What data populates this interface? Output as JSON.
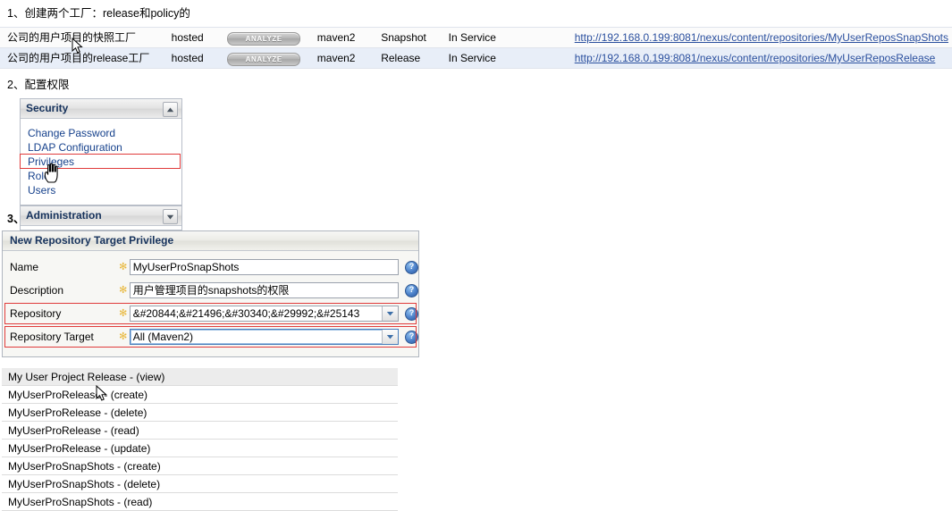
{
  "steps": {
    "step1": "1、创建两个工厂：release和policy的",
    "step2": "2、配置权限",
    "step3": "3、"
  },
  "repo_table": {
    "rows": [
      {
        "name": "公司的用户项目的快照工厂",
        "type": "hosted",
        "action_label": "ANALYZE",
        "format": "maven2",
        "policy": "Snapshot",
        "status": "In Service",
        "url": "http://192.168.0.199:8081/nexus/content/repositories/MyUserReposSnapShots"
      },
      {
        "name": "公司的用户项目的release工厂",
        "type": "hosted",
        "action_label": "ANALYZE",
        "format": "maven2",
        "policy": "Release",
        "status": "In Service",
        "url": "http://192.168.0.199:8081/nexus/content/repositories/MyUserReposRelease"
      }
    ]
  },
  "security_panel": {
    "title": "Security",
    "toggle_icon": "collapse-up-icon",
    "items": [
      {
        "label": "Change Password"
      },
      {
        "label": "LDAP Configuration"
      },
      {
        "label": "Privileges"
      },
      {
        "label": "Roles"
      },
      {
        "label": "Users"
      }
    ]
  },
  "admin_panel": {
    "title": "Administration",
    "toggle_icon": "expand-down-icon"
  },
  "privilege_form": {
    "title": "New Repository Target Privilege",
    "required_marker": "✻",
    "help_glyph": "?",
    "fields": [
      {
        "label": "Name",
        "value": "MyUserProSnapShots",
        "kind": "text",
        "highlighted": false,
        "focused": false
      },
      {
        "label": "Description",
        "value": "用户管理项目的snapshots的权限",
        "kind": "text",
        "highlighted": false,
        "focused": false
      },
      {
        "label": "Repository",
        "value": "&#20844;&#21496;&#30340;&#29992;&#25143",
        "kind": "select",
        "highlighted": true,
        "focused": false
      },
      {
        "label": "Repository Target",
        "value": "All (Maven2)",
        "kind": "select",
        "highlighted": true,
        "focused": true
      }
    ]
  },
  "privilege_list": {
    "items": [
      {
        "label": "My User Project Release - (view)",
        "selected": true
      },
      {
        "label": "MyUserProRelease - (create)",
        "selected": false
      },
      {
        "label": "MyUserProRelease - (delete)",
        "selected": false
      },
      {
        "label": "MyUserProRelease - (read)",
        "selected": false
      },
      {
        "label": "MyUserProRelease - (update)",
        "selected": false
      },
      {
        "label": "MyUserProSnapShots - (create)",
        "selected": false
      },
      {
        "label": "MyUserProSnapShots - (delete)",
        "selected": false
      },
      {
        "label": "MyUserProSnapShots - (read)",
        "selected": false
      }
    ]
  },
  "colors": {
    "highlight_red": "#e03b3b",
    "link_blue": "#16418c",
    "url_blue": "#2a4f9e",
    "row_even": "#e8eef8",
    "panel_title": "#16325c"
  }
}
